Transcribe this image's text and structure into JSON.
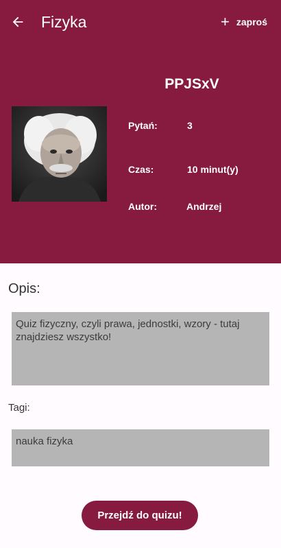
{
  "toolbar": {
    "title": "Fizyka",
    "invite_label": "zaproś",
    "back_icon": "arrow-left-icon",
    "invite_icon": "plus-icon"
  },
  "quiz": {
    "code": "PPJSxV",
    "questions_label": "Pytań:",
    "questions_value": "3",
    "time_label": "Czas:",
    "time_value": "10 minut(y)",
    "author_label": "Autor:",
    "author_value": "Andrzej"
  },
  "description": {
    "heading": "Opis:",
    "text": "Quiz fizyczny, czyli prawa, jednostki, wzory - tutaj znajdziesz wszystko!"
  },
  "tags": {
    "label": "Tagi:",
    "text": "nauka fizyka"
  },
  "start_button": "Przejdź do quizu!",
  "colors": {
    "primary": "#861b3f",
    "box_bg": "#b5b5b5",
    "page_bg": "#fffbfe"
  }
}
